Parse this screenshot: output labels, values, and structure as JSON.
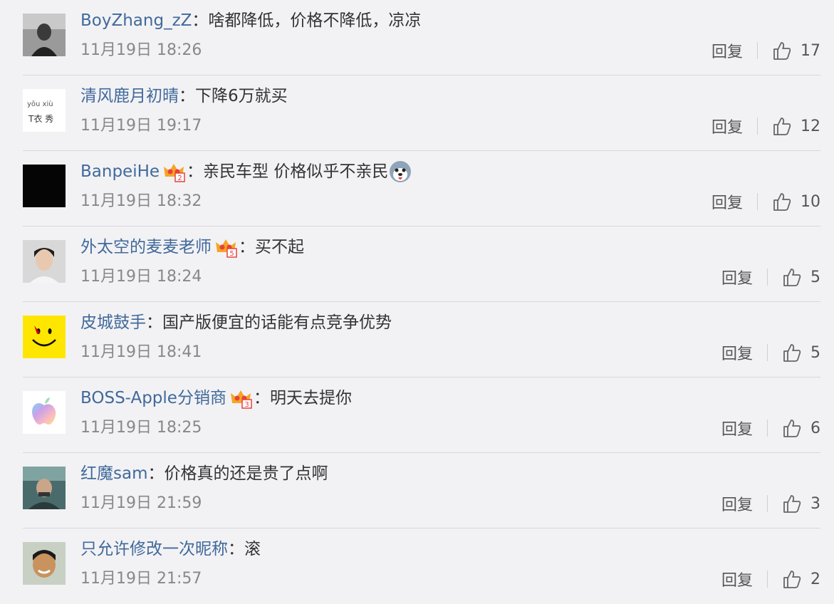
{
  "comments": [
    {
      "username": "BoyZhang_zZ",
      "text": "啥都降低，价格不降低，凉凉",
      "time": "11月19日 18:26",
      "reply": "回复",
      "likes": "17",
      "avatar": "avatar-dark-portrait",
      "badge": null,
      "emoji": null
    },
    {
      "username": "清风鹿月初晴",
      "text": "下降6万就买",
      "time": "11月19日 19:17",
      "reply": "回复",
      "likes": "12",
      "avatar": "avatar-handwriting",
      "badge": null,
      "emoji": null
    },
    {
      "username": "BanpeiHe",
      "text": "亲民车型 价格似乎不亲民",
      "time": "11月19日 18:32",
      "reply": "回复",
      "likes": "10",
      "avatar": "avatar-black",
      "badge": "2",
      "emoji": "husky-emoji"
    },
    {
      "username": "外太空的麦麦老师",
      "text": "买不起",
      "time": "11月19日 18:24",
      "reply": "回复",
      "likes": "5",
      "avatar": "avatar-man-portrait",
      "badge": "5",
      "emoji": null
    },
    {
      "username": "皮城鼓手",
      "text": "国产版便宜的话能有点竞争优势",
      "time": "11月19日 18:41",
      "reply": "回复",
      "likes": "5",
      "avatar": "avatar-yellow-smiley",
      "badge": null,
      "emoji": null
    },
    {
      "username": "BOSS-Apple分销商",
      "text": "明天去提你",
      "time": "11月19日 18:25",
      "reply": "回复",
      "likes": "6",
      "avatar": "avatar-apple-logo",
      "badge": "3",
      "emoji": null
    },
    {
      "username": "红魔sam",
      "text": "价格真的还是贵了点啊",
      "time": "11月19日 21:59",
      "reply": "回复",
      "likes": "3",
      "avatar": "avatar-concert",
      "badge": null,
      "emoji": null
    },
    {
      "username": "只允许修改一次昵称",
      "text": "滚",
      "time": "11月19日 21:57",
      "reply": "回复",
      "likes": "2",
      "avatar": "avatar-boy-portrait",
      "badge": null,
      "emoji": null
    }
  ],
  "separator": "：",
  "colors": {
    "username": "#41699a",
    "text": "#333333",
    "meta": "#888888",
    "background": "#f2f2f5",
    "divider": "#d8d8dc"
  },
  "avatar_text": {
    "line1": "yōu xiù",
    "line2": "T衣 秀"
  }
}
